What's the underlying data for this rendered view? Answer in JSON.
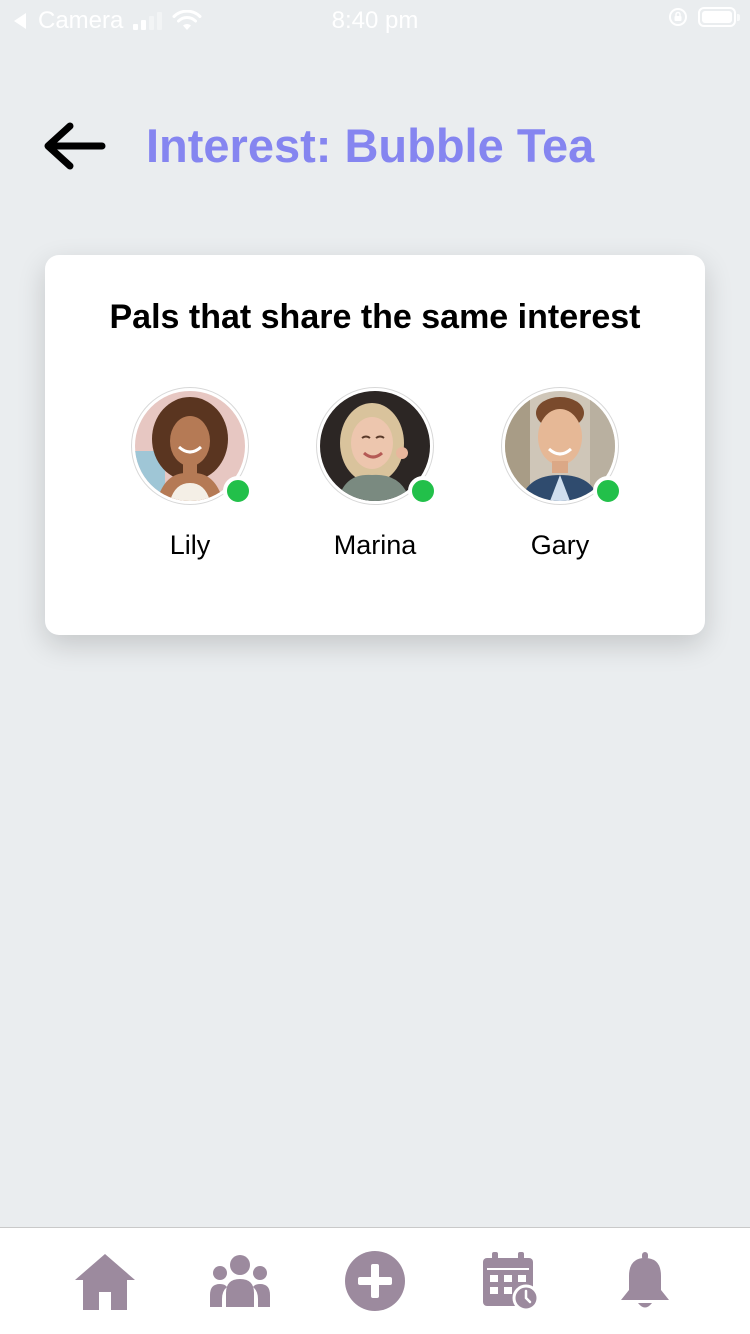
{
  "status_bar": {
    "carrier": "Camera",
    "time": "8:40 pm"
  },
  "header": {
    "title": "Interest: Bubble Tea"
  },
  "card": {
    "title": "Pals that share the same interest",
    "pals": [
      {
        "name": "Lily",
        "status": "online"
      },
      {
        "name": "Marina",
        "status": "online"
      },
      {
        "name": "Gary",
        "status": "online"
      }
    ]
  },
  "bottom_nav": {
    "items": [
      {
        "icon": "home-icon"
      },
      {
        "icon": "people-icon"
      },
      {
        "icon": "add-circle-icon"
      },
      {
        "icon": "calendar-icon"
      },
      {
        "icon": "bell-icon"
      }
    ]
  },
  "colors": {
    "accent": "#8585f0",
    "nav_icon": "#9c8a9e",
    "online": "#22c04a",
    "background": "#eaedef"
  }
}
